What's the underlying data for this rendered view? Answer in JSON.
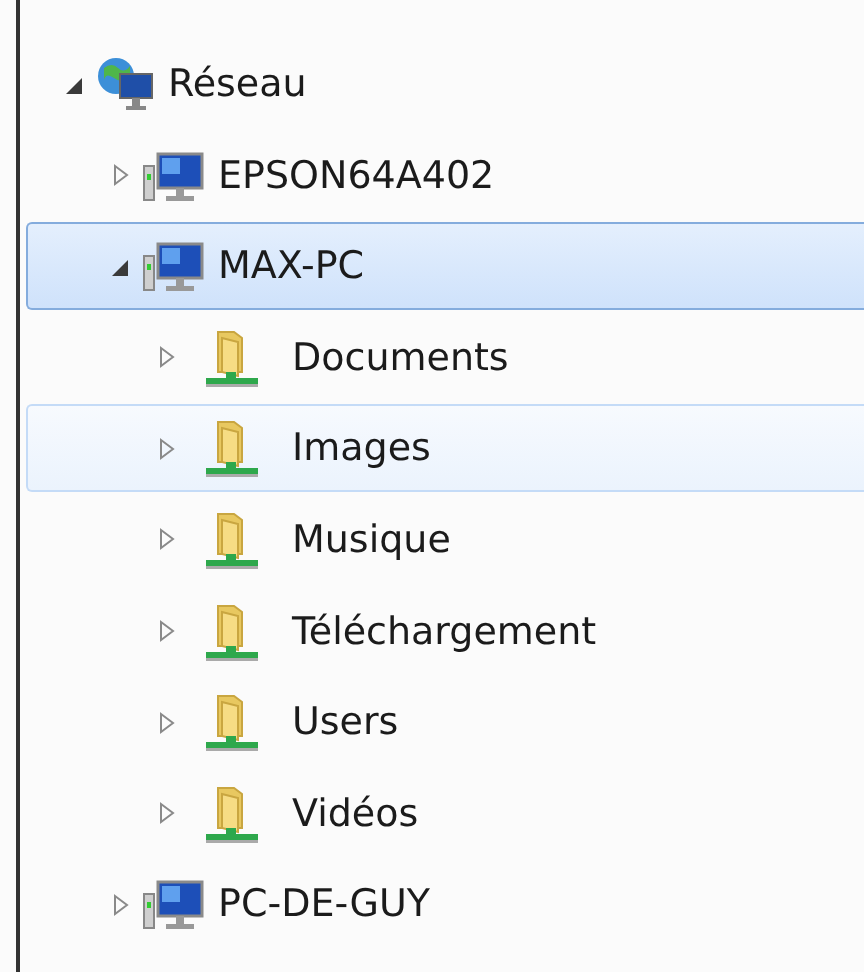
{
  "tree": [
    {
      "label": "Réseau",
      "kind": "network",
      "expanded": true,
      "selected": false,
      "hovered": false,
      "children": [
        {
          "label": "EPSON64A402",
          "kind": "computer",
          "expanded": false,
          "selected": false,
          "hovered": false
        },
        {
          "label": "MAX-PC",
          "kind": "computer",
          "expanded": true,
          "selected": true,
          "hovered": false,
          "children": [
            {
              "label": "Documents",
              "kind": "share",
              "expanded": false,
              "selected": false,
              "hovered": false
            },
            {
              "label": "Images",
              "kind": "share",
              "expanded": false,
              "selected": false,
              "hovered": true
            },
            {
              "label": "Musique",
              "kind": "share",
              "expanded": false,
              "selected": false,
              "hovered": false
            },
            {
              "label": "Téléchargement",
              "kind": "share",
              "expanded": false,
              "selected": false,
              "hovered": false
            },
            {
              "label": "Users",
              "kind": "share",
              "expanded": false,
              "selected": false,
              "hovered": false
            },
            {
              "label": "Vidéos",
              "kind": "share",
              "expanded": false,
              "selected": false,
              "hovered": false
            }
          ]
        },
        {
          "label": "PC-DE-GUY",
          "kind": "computer",
          "expanded": false,
          "selected": false,
          "hovered": false
        }
      ]
    }
  ]
}
